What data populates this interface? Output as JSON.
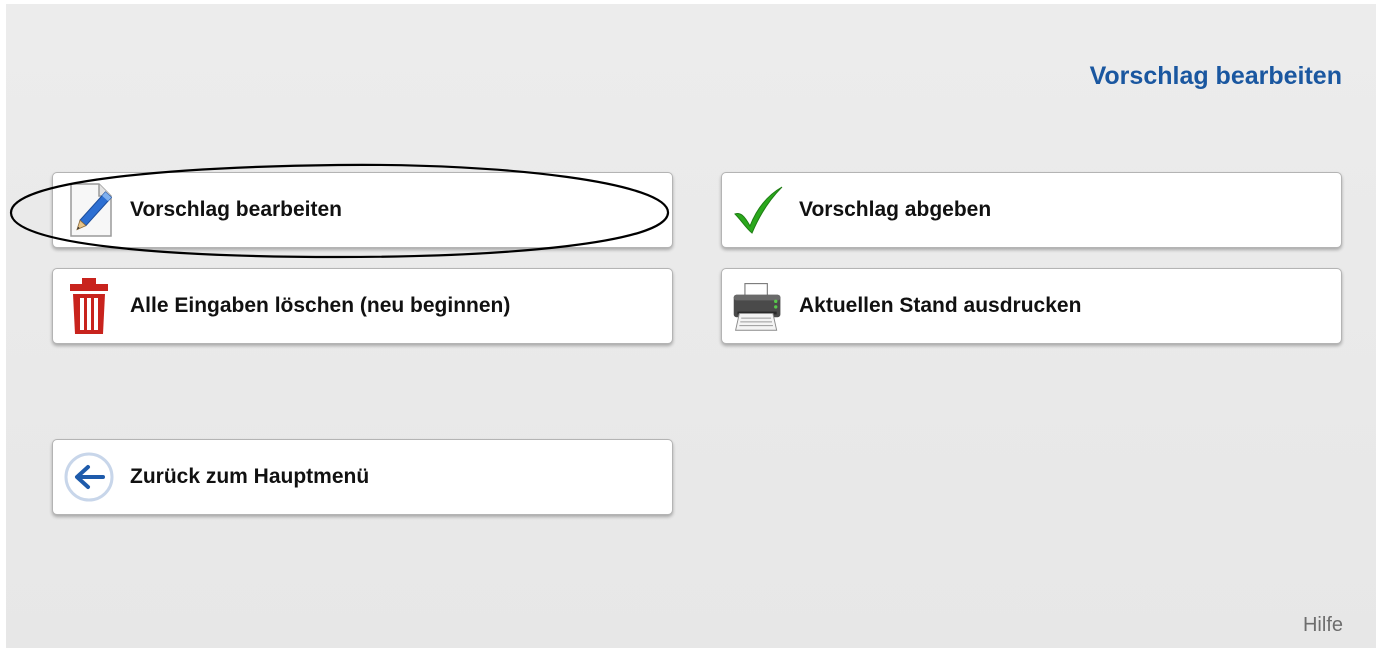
{
  "page": {
    "title": "Vorschlag bearbeiten",
    "help": "Hilfe"
  },
  "buttons": {
    "edit": {
      "label": "Vorschlag bearbeiten",
      "icon": "pencil-document-icon"
    },
    "submit": {
      "label": "Vorschlag abgeben",
      "icon": "checkmark-icon"
    },
    "reset": {
      "label": "Alle Eingaben löschen (neu beginnen)",
      "icon": "trash-icon"
    },
    "print": {
      "label": "Aktuellen Stand ausdrucken",
      "icon": "printer-icon"
    },
    "back": {
      "label": "Zurück zum Hauptmenü",
      "icon": "back-arrow-icon"
    }
  },
  "colors": {
    "title": "#1a57a0",
    "check": "#2aa81c",
    "trash": "#c8231d",
    "back_arrow": "#1e5bab"
  }
}
